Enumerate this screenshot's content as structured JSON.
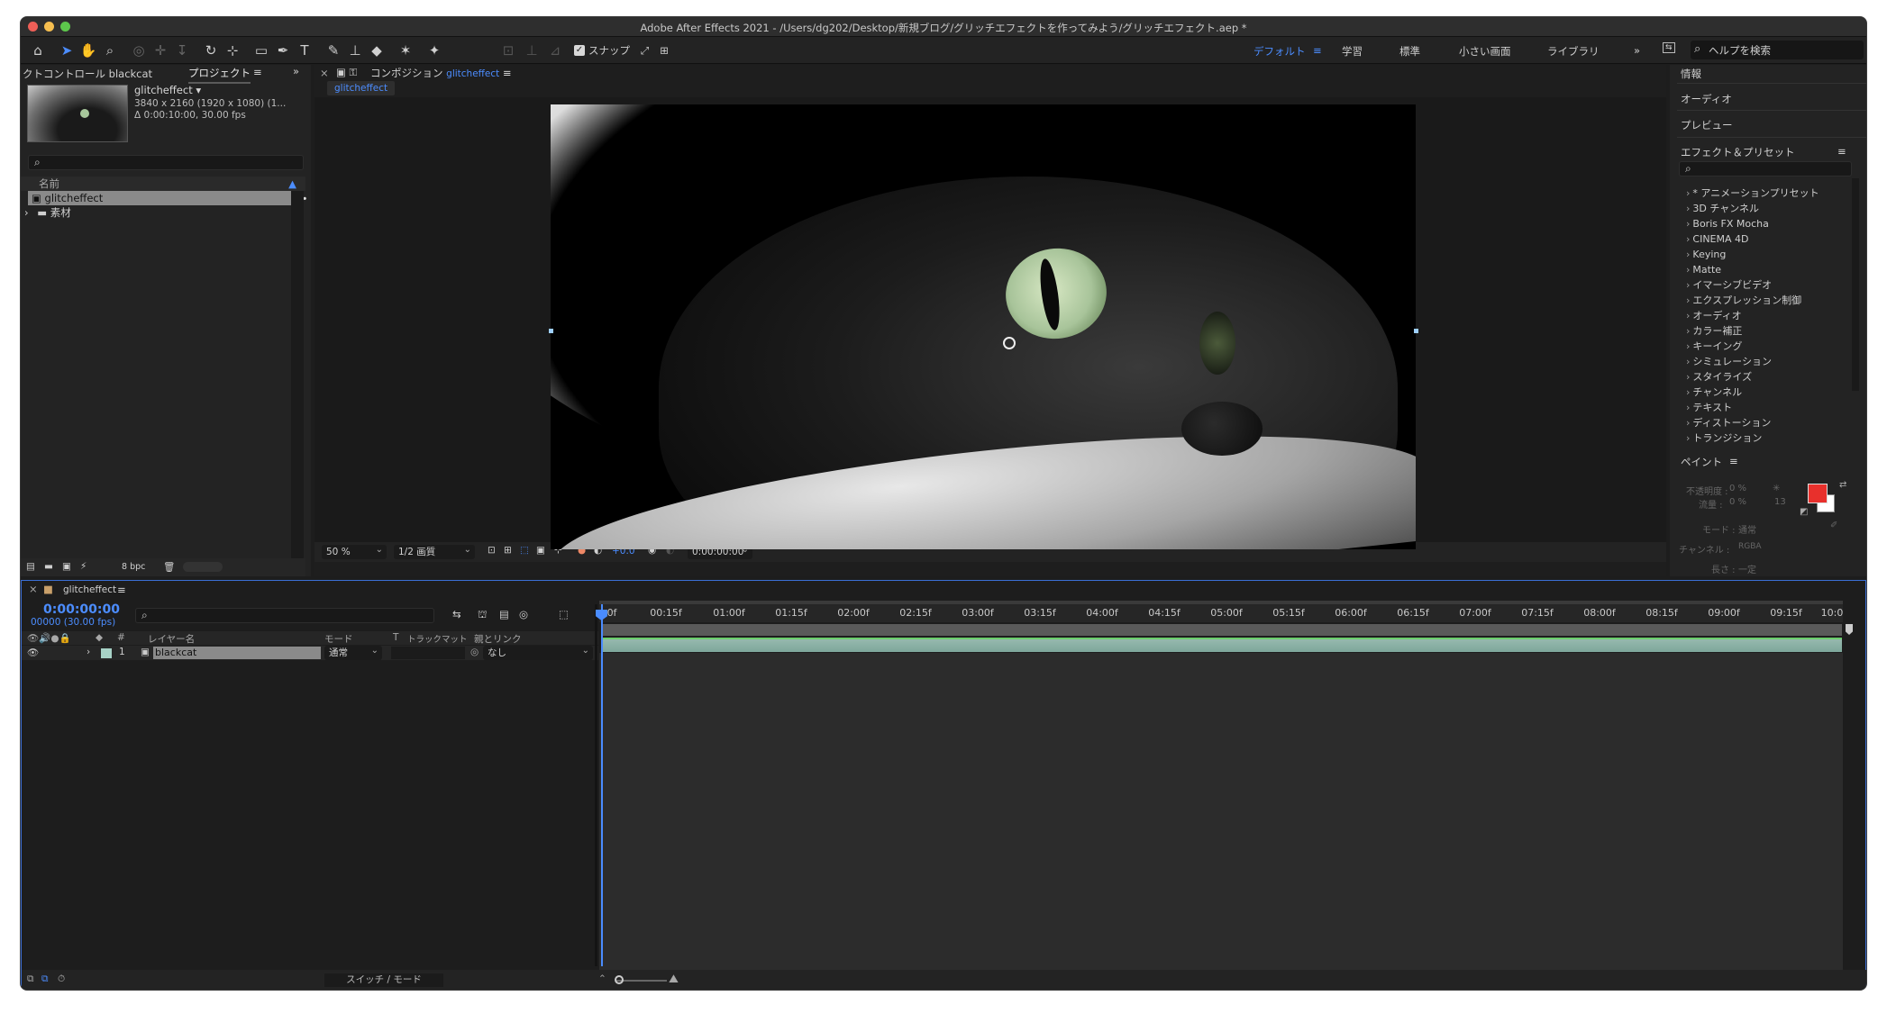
{
  "window": {
    "title": "Adobe After Effects 2021 - /Users/dg202/Desktop/新規ブログ/グリッチエフェクトを作ってみよう/グリッチエフェクト.aep *"
  },
  "toolbar": {
    "snap_label": "スナップ",
    "workspaces": [
      "デフォルト",
      "学習",
      "標準",
      "小さい画面",
      "ライブラリ"
    ],
    "more": "»",
    "help_placeholder": "ヘルプを検索"
  },
  "project": {
    "tab_effect_controls": "クトコントロール blackcat",
    "tab_project": "プロジェクト",
    "item_name": "glitcheffect ▾",
    "item_size": "3840 x 2160 (1920 x 1080) (1...",
    "item_duration": "Δ 0:00:10:00, 30.00 fps",
    "col_name": "名前",
    "items": [
      "glitcheffect",
      "素材"
    ],
    "bpc": "8 bpc"
  },
  "composition": {
    "tab_label": "コンポジション",
    "tab_name": "glitcheffect",
    "subtab": "glitcheffect",
    "zoom": "50 %",
    "quality": "1/2 画質",
    "exposure": "+0.0",
    "timecode": "0:00:00:00"
  },
  "right_panel": {
    "info": "情報",
    "audio": "オーディオ",
    "preview": "プレビュー",
    "effects_title": "エフェクト＆プリセット",
    "effects": [
      "* アニメーションプリセット",
      "3D チャンネル",
      "Boris FX Mocha",
      "CINEMA 4D",
      "Keying",
      "Matte",
      "イマーシブビデオ",
      "エクスプレッション制御",
      "オーディオ",
      "カラー補正",
      "キーイング",
      "シミュレーション",
      "スタイライズ",
      "チャンネル",
      "テキスト",
      "ディストーション",
      "トランジション"
    ],
    "paint_title": "ペイント",
    "opacity_label": "不透明度 :",
    "opacity_value": "0 %",
    "flow_label": "流量 :",
    "flow_value": "0 %",
    "brush_size": "13",
    "mode_label": "モード :",
    "mode_value": "通常",
    "channel_label": "チャンネル :",
    "channel_value": "RGBA",
    "duration_label": "長さ :",
    "duration_value": "一定",
    "fg_color": "#e8302c",
    "bg_color": "#ffffff"
  },
  "timeline": {
    "tab_name": "glitcheffect",
    "timecode": "0:00:00:00",
    "frames": "00000 (30.00 fps)",
    "col_num": "#",
    "col_layer": "レイヤー名",
    "col_mode": "モード",
    "col_t": "T",
    "col_track": "トラックマット",
    "col_parent": "親とリンク",
    "layer_index": "1",
    "layer_name": "blackcat",
    "layer_mode": "通常",
    "layer_parent": "なし",
    "ruler": [
      "0f",
      "00:15f",
      "01:00f",
      "01:15f",
      "02:00f",
      "02:15f",
      "03:00f",
      "03:15f",
      "04:00f",
      "04:15f",
      "05:00f",
      "05:15f",
      "06:00f",
      "06:15f",
      "07:00f",
      "07:15f",
      "08:00f",
      "08:15f",
      "09:00f",
      "09:15f",
      "10:0"
    ],
    "switch_mode": "スイッチ / モード"
  }
}
